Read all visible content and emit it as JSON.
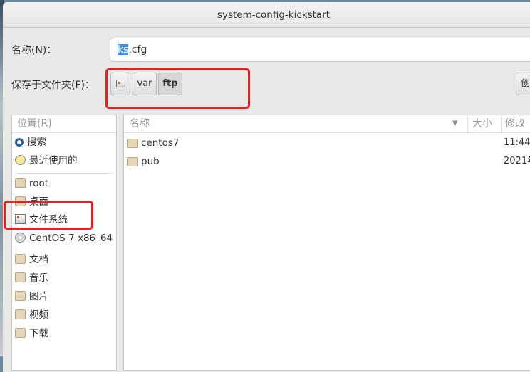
{
  "window": {
    "title": "system-config-kickstart"
  },
  "name_label": "名称(N)：",
  "name_value_selected": "ks",
  "name_value_rest": ".cfg",
  "folder_label": "保存于文件夹(F)：",
  "path": [
    {
      "icon": "drive-icon"
    },
    {
      "label": "var"
    },
    {
      "label": "ftp",
      "active": true
    }
  ],
  "create_folder_label": "创",
  "places": {
    "header": "位置(R)",
    "items": [
      {
        "label": "搜索",
        "icon": "search-icon"
      },
      {
        "label": "最近使用的",
        "icon": "recent-icon"
      },
      {
        "label": "root",
        "icon": "home-folder-icon"
      },
      {
        "label": "桌面",
        "icon": "desktop-folder-icon"
      },
      {
        "label": "文件系统",
        "icon": "drive-icon"
      },
      {
        "label": "CentOS 7 x86_64",
        "icon": "disc-icon"
      },
      {
        "label": "文档",
        "icon": "documents-folder-icon"
      },
      {
        "label": "音乐",
        "icon": "music-folder-icon"
      },
      {
        "label": "图片",
        "icon": "pictures-folder-icon"
      },
      {
        "label": "视频",
        "icon": "videos-folder-icon"
      },
      {
        "label": "下载",
        "icon": "downloads-folder-icon"
      }
    ]
  },
  "files": {
    "columns": [
      "名称",
      "大小",
      "修改"
    ],
    "rows": [
      {
        "name": "centos7",
        "size": "",
        "modified": "11:44"
      },
      {
        "name": "pub",
        "size": "",
        "modified": "2021年"
      }
    ]
  },
  "highlight_color": "#f01c1c"
}
